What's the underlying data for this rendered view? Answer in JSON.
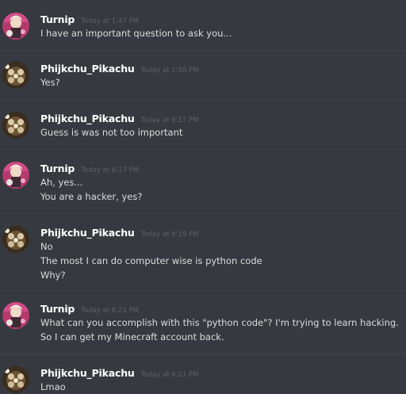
{
  "messages": [
    {
      "username": "Turnip",
      "timestamp": "Today at 1:47 PM",
      "avatar": "turnip-avatar",
      "lines": [
        "I have an important question to ask you..."
      ]
    },
    {
      "username": "Phijkchu_Pikachu",
      "timestamp": "Today at 1:56 PM",
      "avatar": "pikachu-avatar",
      "lines": [
        "Yes?"
      ]
    },
    {
      "username": "Phijkchu_Pikachu",
      "timestamp": "Today at 6:17 PM",
      "avatar": "pikachu-avatar",
      "lines": [
        "Guess is was not too important"
      ]
    },
    {
      "username": "Turnip",
      "timestamp": "Today at 6:17 PM",
      "avatar": "turnip-avatar",
      "lines": [
        "Ah, yes...",
        "You are a hacker, yes?"
      ]
    },
    {
      "username": "Phijkchu_Pikachu",
      "timestamp": "Today at 6:19 PM",
      "avatar": "pikachu-avatar",
      "lines": [
        "No",
        "The most I can do computer wise is python code",
        "Why?"
      ]
    },
    {
      "username": "Turnip",
      "timestamp": "Today at 6:21 PM",
      "avatar": "turnip-avatar",
      "lines": [
        "What can you accomplish with this \"python code\"?  I'm trying to learn hacking.",
        "So I can get my Minecraft account back."
      ]
    },
    {
      "username": "Phijkchu_Pikachu",
      "timestamp": "Today at 6:21 PM",
      "avatar": "pikachu-avatar",
      "lines": [
        "Lmao"
      ]
    }
  ],
  "colors": {
    "background": "#36393f",
    "username": "#ffffff",
    "timestamp": "#5e6166",
    "message_text": "#dcddde"
  }
}
